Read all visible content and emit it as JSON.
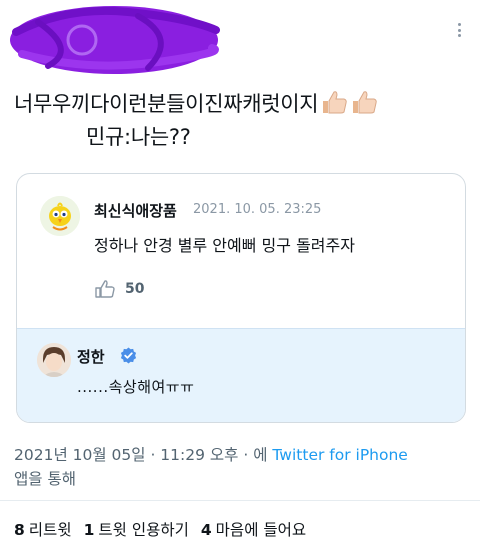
{
  "tweet": {
    "line1": "너무우끼다이런분들이진짜캐럿이지",
    "line2": "민규:나는??"
  },
  "quoted_tweet": {
    "author": "최신식애장품",
    "date": "2021. 10. 05. 23:25",
    "text": "정하나 안경 별루 안예뻐 밍구 돌려주자",
    "like_count": "50"
  },
  "reply": {
    "author": "정한",
    "text": "......속상해여ㅠㅠ"
  },
  "meta": {
    "timestamp": "2021년 10월 05일 · 11:29 오후 · 에",
    "source": "Twitter for iPhone",
    "suffix": "앱을 통해"
  },
  "stats": [
    {
      "count": "8",
      "label": "리트윗"
    },
    {
      "count": "1",
      "label": "트윗 인용하기"
    },
    {
      "count": "4",
      "label": "마음에 들어요"
    }
  ],
  "colors": {
    "accent": "#1d9bf0",
    "scribble": "#8a1fe0",
    "reply_bg": "#e6f3fd"
  }
}
